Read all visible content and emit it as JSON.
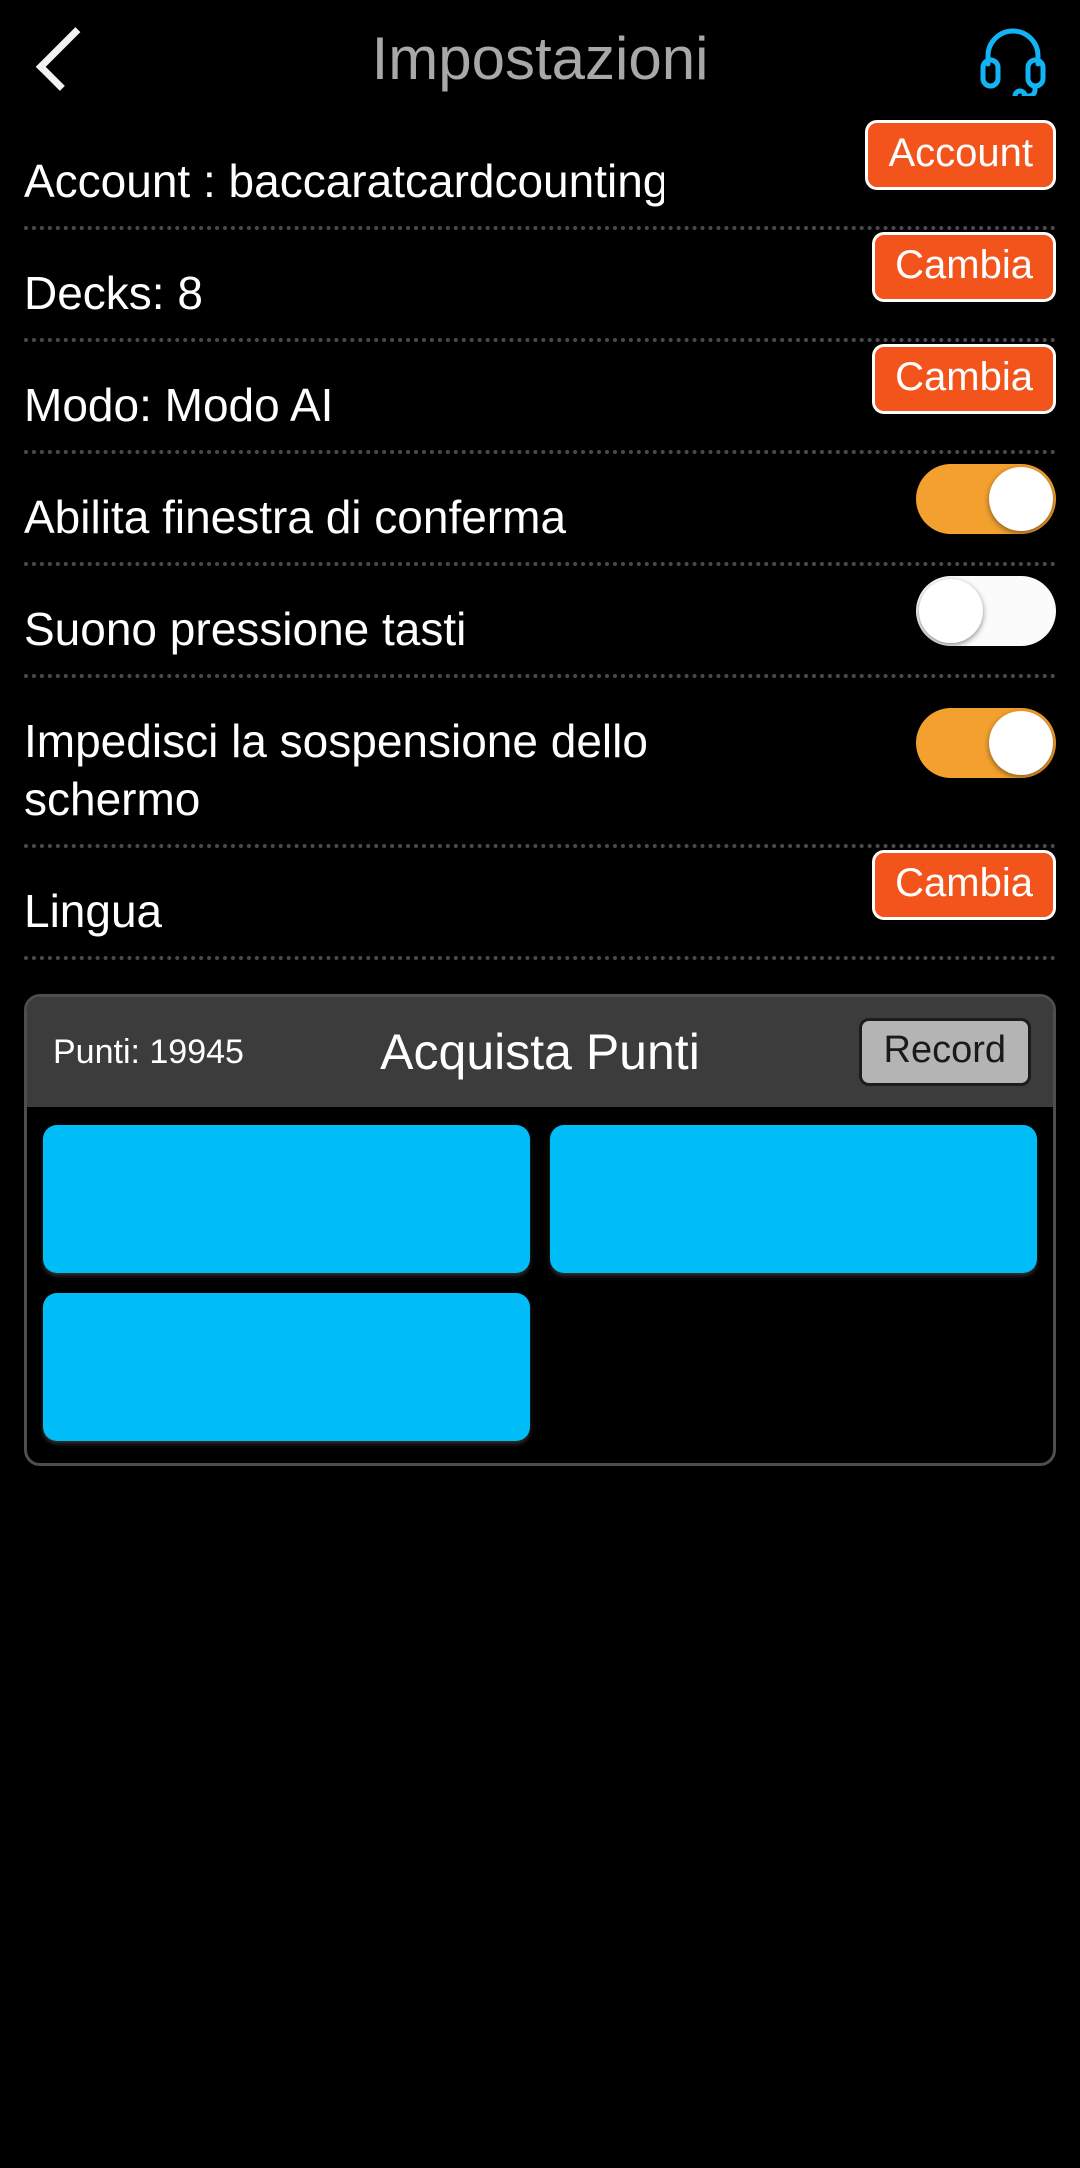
{
  "header": {
    "title": "Impostazioni",
    "back_icon": "chevron-left-icon",
    "support_icon": "headset-icon",
    "support_color": "#12b4f5"
  },
  "colors": {
    "background": "#000000",
    "accent_orange": "#f2541b",
    "toggle_on": "#f3a02e",
    "toggle_off": "#fbfbfb",
    "tile_cyan": "#00bdf8",
    "panel_header": "#3c3c3c",
    "divider": "#4a4a4a",
    "title_gray": "#a8a8a8"
  },
  "settings": [
    {
      "label": "Account : baccaratcardcounting@",
      "control": "button",
      "button_label": "Account",
      "multiline": false
    },
    {
      "label": "Decks: 8",
      "control": "button",
      "button_label": "Cambia",
      "multiline": false
    },
    {
      "label": "Modo: Modo AI",
      "control": "button",
      "button_label": "Cambia",
      "multiline": false
    },
    {
      "label": "Abilita finestra di conferma",
      "control": "toggle",
      "toggle_state": "on",
      "multiline": false
    },
    {
      "label": "Suono pressione tasti",
      "control": "toggle",
      "toggle_state": "off",
      "multiline": false
    },
    {
      "label": "Impedisci la sospensione dello schermo",
      "control": "toggle",
      "toggle_state": "on",
      "multiline": true
    },
    {
      "label": "Lingua",
      "control": "button",
      "button_label": "Cambia",
      "multiline": false
    }
  ],
  "purchase_panel": {
    "points_label": "Punti: 19945",
    "title": "Acquista Punti",
    "record_label": "Record",
    "tiles": [
      "",
      "",
      ""
    ]
  }
}
